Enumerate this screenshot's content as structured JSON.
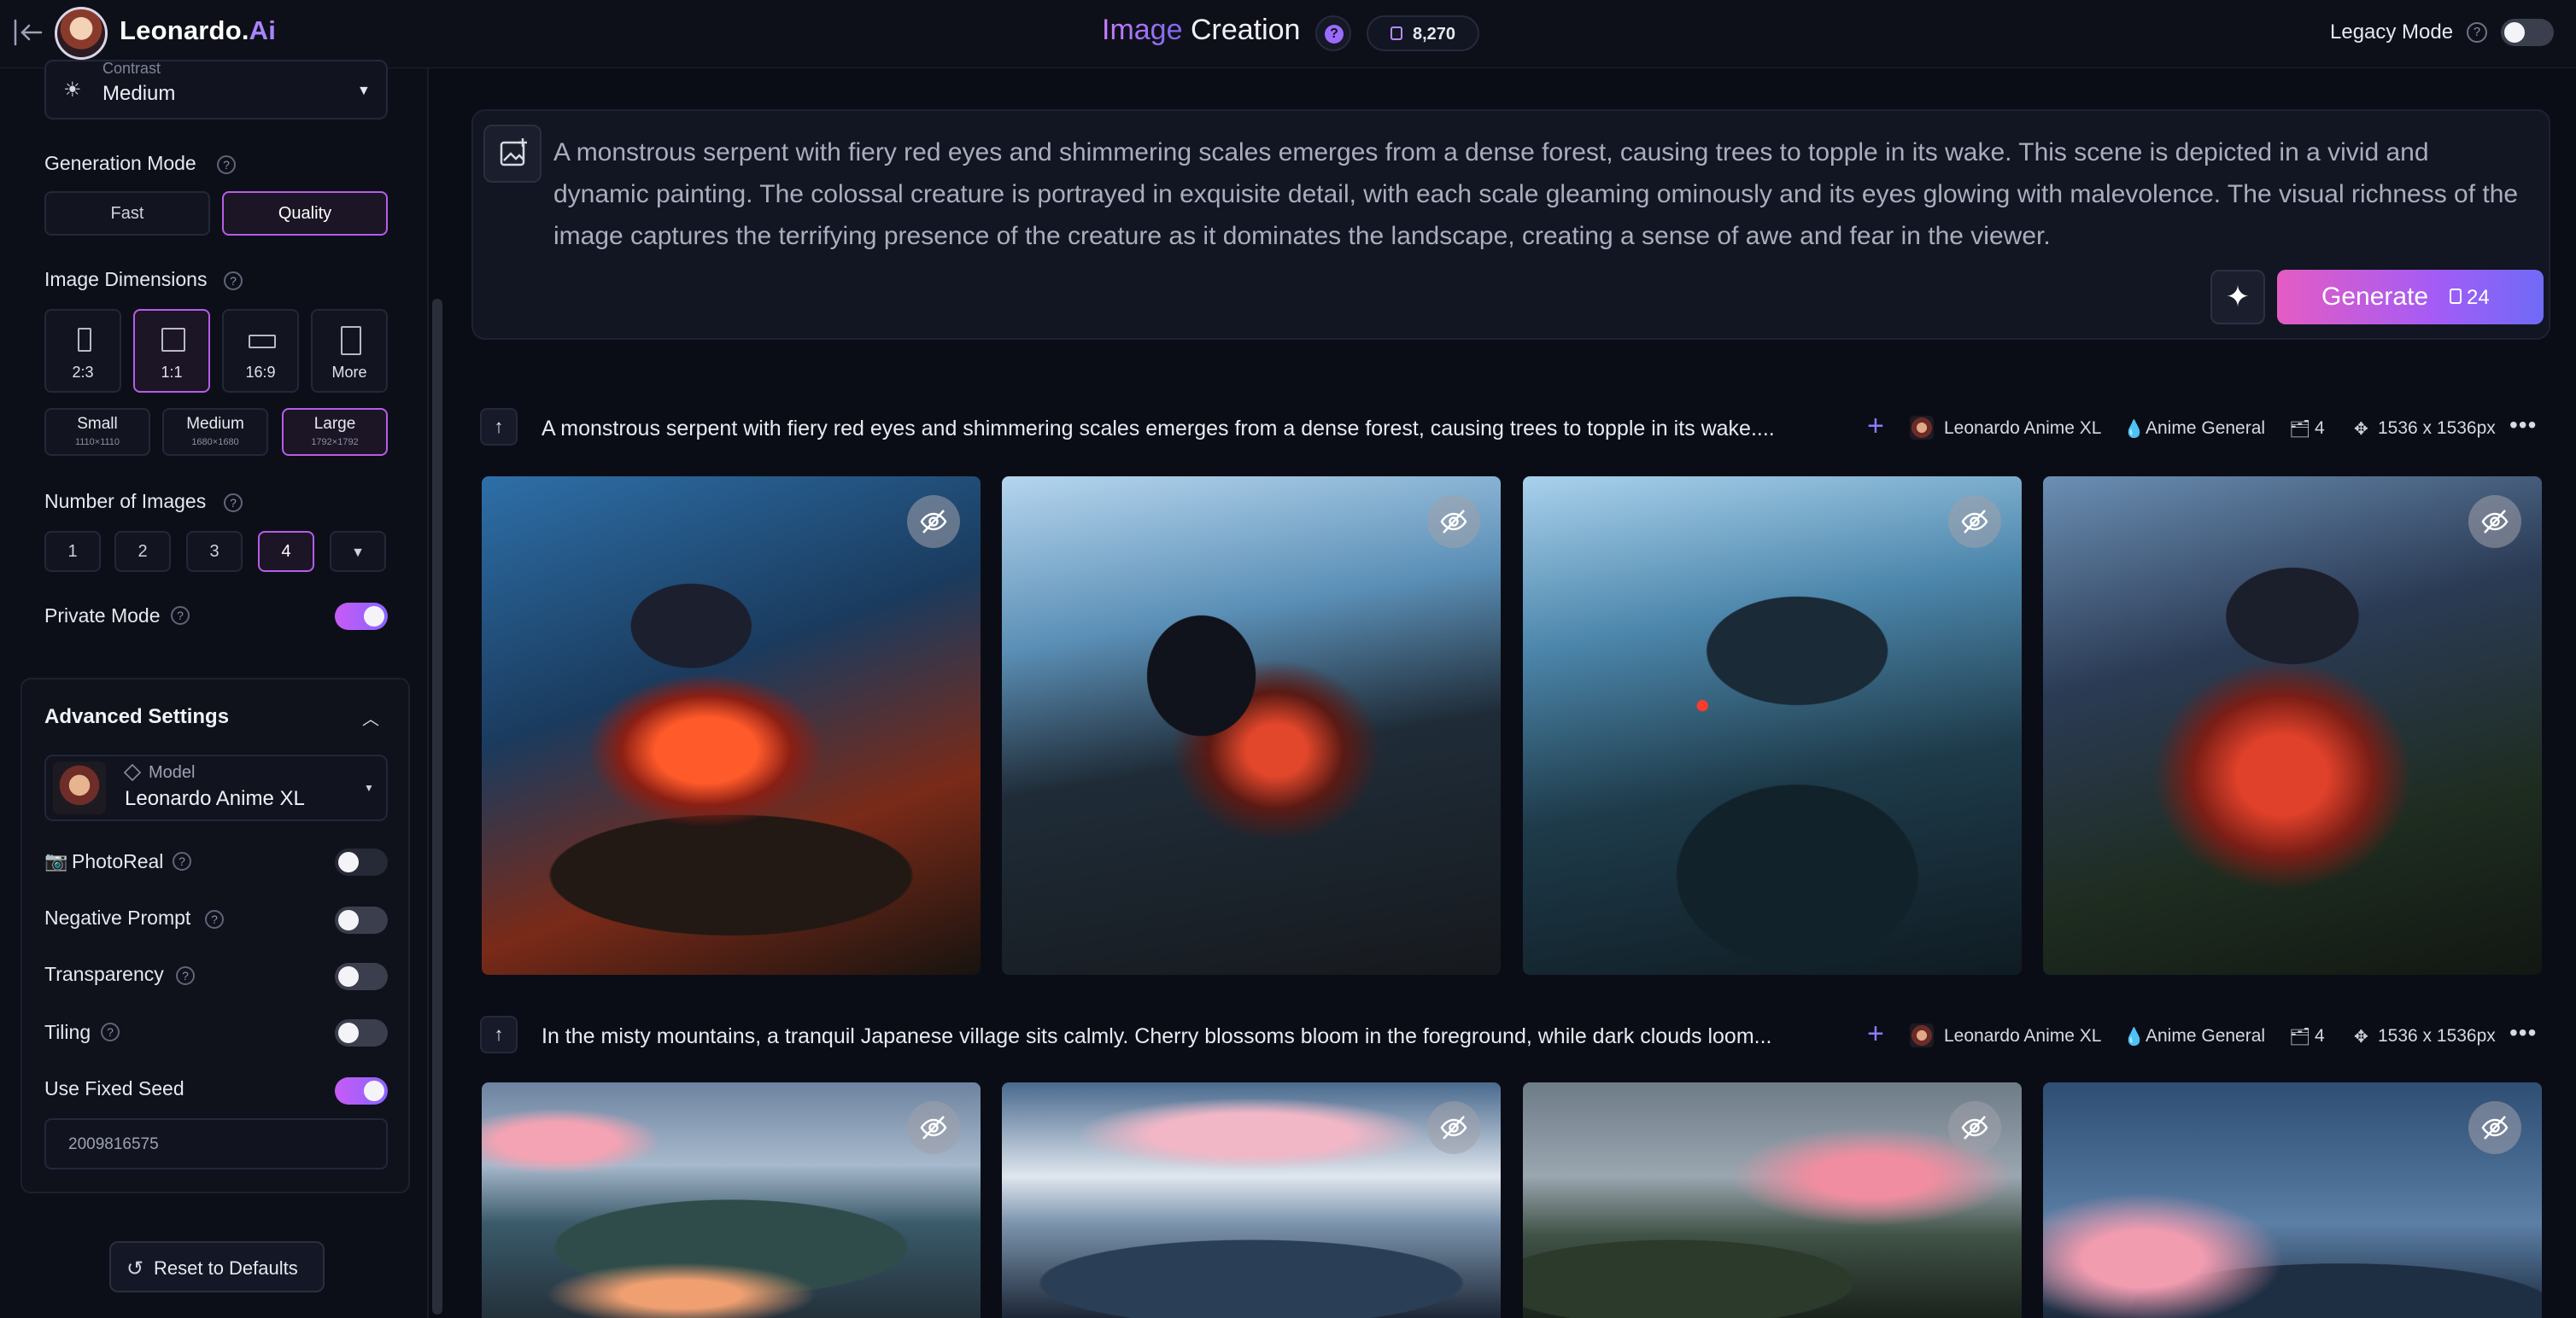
{
  "header": {
    "brand_name": "Leonardo.",
    "brand_suffix": "Ai",
    "title_accent": "Image",
    "title_rest": " Creation",
    "help_glyph": "?",
    "tokens": "8,270",
    "legacy_mode_label": "Legacy Mode",
    "legacy_mode_on": false
  },
  "sidebar": {
    "contrast": {
      "label": "Contrast",
      "value": "Medium"
    },
    "generation_mode": {
      "label": "Generation Mode",
      "options": [
        "Fast",
        "Quality"
      ],
      "selected": "Quality"
    },
    "image_dimensions": {
      "label": "Image Dimensions",
      "ratios": [
        "2:3",
        "1:1",
        "16:9",
        "More"
      ],
      "selected_ratio": "1:1",
      "sizes": [
        {
          "name": "Small",
          "res": "1110×1110"
        },
        {
          "name": "Medium",
          "res": "1680×1680"
        },
        {
          "name": "Large",
          "res": "1792×1792"
        }
      ],
      "selected_size": "Large"
    },
    "number_of_images": {
      "label": "Number of Images",
      "options": [
        "1",
        "2",
        "3",
        "4"
      ],
      "selected": "4"
    },
    "private_mode": {
      "label": "Private Mode",
      "on": true
    },
    "advanced": {
      "title": "Advanced Settings",
      "model_label": "Model",
      "model_value": "Leonardo Anime XL",
      "photoreal": {
        "label": "PhotoReal",
        "on": false
      },
      "negative_prompt": {
        "label": "Negative Prompt",
        "on": false
      },
      "transparency": {
        "label": "Transparency",
        "on": false
      },
      "tiling": {
        "label": "Tiling",
        "on": false
      },
      "fixed_seed": {
        "label": "Use Fixed Seed",
        "on": true
      },
      "seed_value": "2009816575"
    },
    "reset_label": "Reset to Defaults"
  },
  "prompt": {
    "text": "A monstrous serpent with fiery red eyes and shimmering scales emerges from a dense forest, causing trees to topple in its wake. This scene is depicted in a vivid and dynamic painting. The colossal creature is portrayed in exquisite detail, with each scale gleaming ominously and its eyes glowing with malevolence. The visual richness of the image captures the terrifying presence of the creature as it dominates the landscape, creating a sense of awe and fear in the viewer.",
    "generate_label": "Generate",
    "generate_cost": "24"
  },
  "generations": [
    {
      "title": "A monstrous serpent with fiery red eyes and shimmering scales emerges from a dense forest, causing trees to topple in its wake....",
      "model": "Leonardo Anime XL",
      "style": "Anime General",
      "count": "4",
      "size": "1536 x 1536px",
      "images": [
        "serpent-1",
        "serpent-2",
        "serpent-3",
        "serpent-4"
      ]
    },
    {
      "title": "In the misty mountains, a tranquil Japanese village sits calmly. Cherry blossoms bloom in the foreground, while dark clouds loom...",
      "model": "Leonardo Anime XL",
      "style": "Anime General",
      "count": "4",
      "size": "1536 x 1536px",
      "images": [
        "village-1",
        "village-2",
        "village-3",
        "village-4"
      ]
    }
  ]
}
